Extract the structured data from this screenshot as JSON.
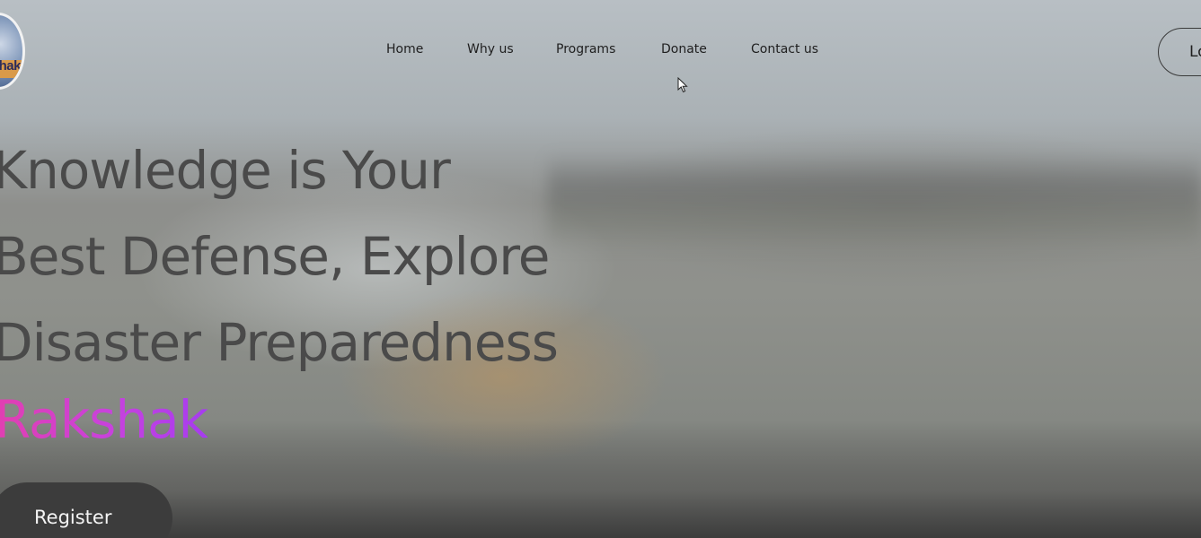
{
  "header": {
    "logo_text": "hak",
    "nav": [
      {
        "label": "Home"
      },
      {
        "label": "Why us"
      },
      {
        "label": "Programs"
      },
      {
        "label": "Donate"
      },
      {
        "label": "Contact us"
      }
    ],
    "login_label": "Lo"
  },
  "hero": {
    "headline_lines": [
      "Knowledge is Your",
      "Best Defense, Explore",
      "Disaster Preparedness"
    ],
    "brand": "Rakshak",
    "register_label": "Register"
  },
  "colors": {
    "headline": "#4a4a4a",
    "brand_gradient_start": "#e23fb0",
    "brand_gradient_end": "#a63cf0",
    "register_bg": "#3c3c3c"
  },
  "icons": {
    "cursor": "mouse-pointer-icon"
  }
}
